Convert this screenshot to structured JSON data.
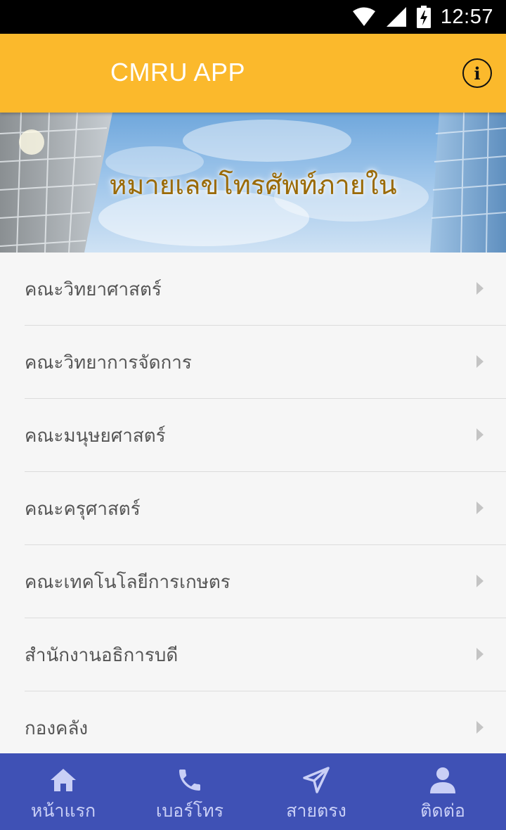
{
  "status_bar": {
    "time": "12:57",
    "icons": [
      "wifi-icon",
      "signal-icon",
      "battery-charging-icon"
    ]
  },
  "app_bar": {
    "title": "CMRU APP",
    "info_icon": "info-icon",
    "info_glyph": "i",
    "background": "#fbb92c"
  },
  "banner": {
    "title": "หมายเลขโทรศัพท์ภายใน",
    "title_color": "#9a6a07"
  },
  "list": {
    "items": [
      {
        "label": "คณะวิทยาศาสตร์"
      },
      {
        "label": "คณะวิทยาการจัดการ"
      },
      {
        "label": "คณะมนุษยศาสตร์"
      },
      {
        "label": "คณะครุศาสตร์"
      },
      {
        "label": "คณะเทคโนโลยีการเกษตร"
      },
      {
        "label": "สำนักงานอธิการบดี"
      },
      {
        "label": "กองคลัง"
      }
    ],
    "chevron_icon": "chevron-right-icon"
  },
  "bottom_nav": {
    "background": "#3f51b5",
    "items": [
      {
        "label": "หน้าแรก",
        "icon": "home-icon"
      },
      {
        "label": "เบอร์โทร",
        "icon": "phone-icon"
      },
      {
        "label": "สายตรง",
        "icon": "send-icon"
      },
      {
        "label": "ติดต่อ",
        "icon": "person-icon"
      }
    ]
  }
}
